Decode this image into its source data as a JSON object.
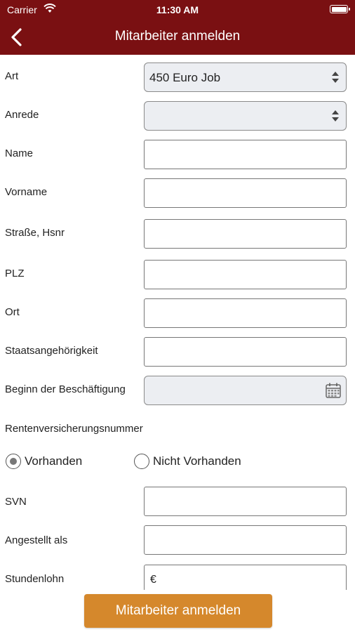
{
  "status_bar": {
    "carrier": "Carrier",
    "time": "11:30 AM"
  },
  "nav": {
    "title": "Mitarbeiter anmelden"
  },
  "form": {
    "art": {
      "label": "Art",
      "value": "450 Euro Job"
    },
    "anrede": {
      "label": "Anrede",
      "value": ""
    },
    "name": {
      "label": "Name",
      "value": ""
    },
    "vorname": {
      "label": "Vorname",
      "value": ""
    },
    "strasse": {
      "label": "Straße, Hsnr",
      "value": ""
    },
    "plz": {
      "label": "PLZ",
      "value": ""
    },
    "ort": {
      "label": "Ort",
      "value": ""
    },
    "staat": {
      "label": "Staatsangehörigkeit",
      "value": ""
    },
    "beginn": {
      "label": "Beginn der Beschäftigung",
      "value": ""
    },
    "rv_section": "Rentenversicherungsnummer",
    "radio_vorhanden": "Vorhanden",
    "radio_nicht": "Nicht Vorhanden",
    "svn": {
      "label": "SVN",
      "value": ""
    },
    "angestellt": {
      "label": "Angestellt als",
      "value": ""
    },
    "stundenlohn": {
      "label": "Stundenlohn",
      "prefix": "€"
    }
  },
  "submit_label": "Mitarbeiter anmelden",
  "colors": {
    "header": "#7a1012",
    "button": "#d5882c"
  },
  "icons": [
    "wifi-icon",
    "battery-icon",
    "back-chevron-icon",
    "select-arrows-icon",
    "calendar-icon"
  ]
}
